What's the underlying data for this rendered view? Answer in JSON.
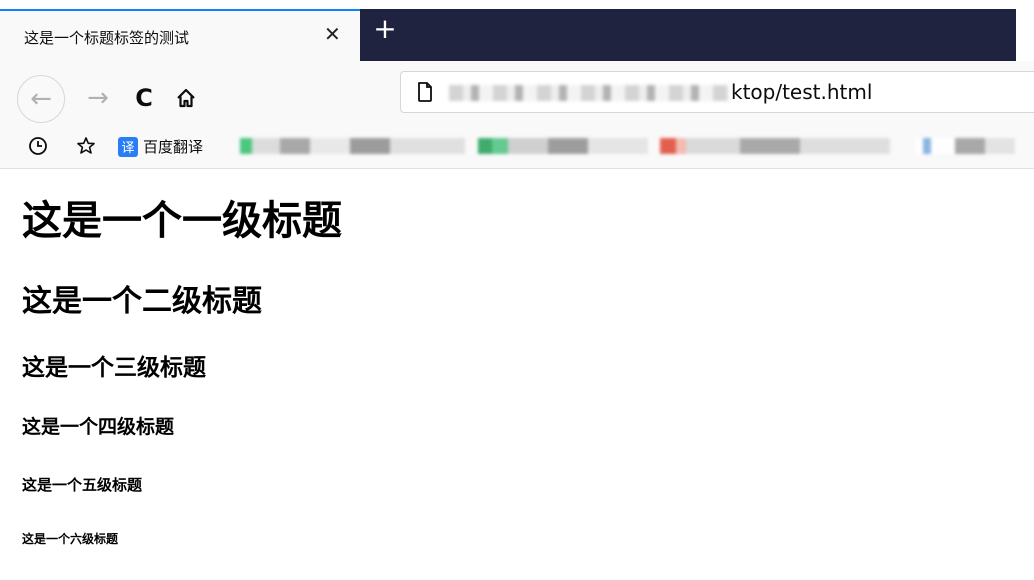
{
  "tab": {
    "title": "这是一个标题标签的测试",
    "close_glyph": "✕",
    "new_tab_glyph": "+"
  },
  "toolbar": {
    "back_glyph": "←",
    "forward_glyph": "→",
    "reload_glyph": "C"
  },
  "urlbar": {
    "visible_url": "ktop/test.html"
  },
  "bookmarks": {
    "translate_badge": "译",
    "translate_label": "百度翻译"
  },
  "page": {
    "h1": "这是一个一级标题",
    "h2": "这是一个二级标题",
    "h3": "这是一个三级标题",
    "h4": "这是一个四级标题",
    "h5": "这是一个五级标题",
    "h6": "这是一个六级标题"
  },
  "colors": {
    "tab_accent": "#0a84ff",
    "tabstrip_dark": "#202340",
    "translate_badge": "#2a7ef5"
  }
}
